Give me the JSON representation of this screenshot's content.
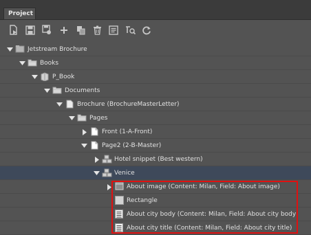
{
  "panel": {
    "tab_label": "Project"
  },
  "toolbar": {
    "buttons": [
      {
        "name": "open-document-icon"
      },
      {
        "name": "save-icon"
      },
      {
        "name": "save-as-icon"
      },
      {
        "name": "add-icon"
      },
      {
        "name": "duplicate-icon"
      },
      {
        "name": "delete-icon"
      },
      {
        "name": "properties-icon"
      },
      {
        "name": "search-icon"
      },
      {
        "name": "refresh-icon"
      }
    ]
  },
  "tree": {
    "rows": [
      {
        "label": "Jetstream Brochure",
        "level": 0,
        "expanded": true,
        "icon": "project-icon"
      },
      {
        "label": "Books",
        "level": 1,
        "expanded": true,
        "icon": "folder-icon"
      },
      {
        "label": "P_Book",
        "level": 2,
        "expanded": true,
        "icon": "book-icon"
      },
      {
        "label": "Documents",
        "level": 3,
        "expanded": true,
        "icon": "folder-icon"
      },
      {
        "label": "Brochure (BrochureMasterLetter)",
        "level": 4,
        "expanded": true,
        "icon": "document-icon"
      },
      {
        "label": "Pages",
        "level": 5,
        "expanded": true,
        "icon": "folder-icon"
      },
      {
        "label": "Front (1-A-Front)",
        "level": 6,
        "expanded": false,
        "icon": "page-icon"
      },
      {
        "label": "Page2 (2-B-Master)",
        "level": 6,
        "expanded": true,
        "icon": "page-icon"
      },
      {
        "label": "Hotel snippet (Best western)",
        "level": 7,
        "expanded": false,
        "icon": "snippet-icon"
      },
      {
        "label": "Venice",
        "level": 7,
        "expanded": true,
        "icon": "snippet-icon",
        "selected": true
      },
      {
        "label": "About image (Content: Milan, Field: About image)",
        "level": 8,
        "expanded": false,
        "icon": "image-frame-icon"
      },
      {
        "label": "Rectangle",
        "level": 8,
        "icon": "rectangle-icon"
      },
      {
        "label": "About city body (Content: Milan, Field: About city body)",
        "level": 8,
        "icon": "text-frame-icon"
      },
      {
        "label": "About city title (Content: Milan, Field: About city title)",
        "level": 8,
        "icon": "text-frame-icon"
      }
    ]
  },
  "colors": {
    "panel_bg": "#535353",
    "selection_bg": "#3e495a",
    "highlight_border": "#e01010"
  }
}
